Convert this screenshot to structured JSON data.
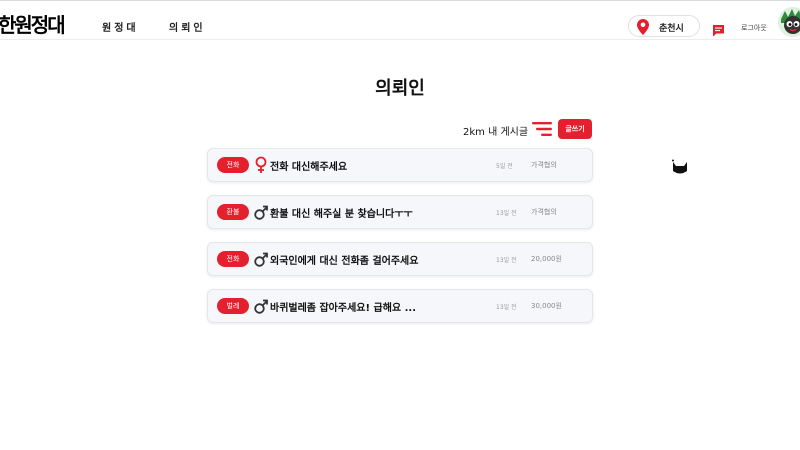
{
  "header": {
    "logo": "한원정대",
    "nav": [
      "원정대",
      "의뢰인"
    ],
    "location": "춘천시",
    "login": "로그아웃"
  },
  "main": {
    "title": "의뢰인",
    "radius_label": "2km 내 게시글",
    "write_button": "글쓰기",
    "posts": [
      {
        "category": "전화",
        "gender": "female",
        "title": "전화 대신해주세요",
        "time": "5일 전",
        "price": "가격협의"
      },
      {
        "category": "환불",
        "gender": "male",
        "title": "환불 대신 해주실 분 찾습니다ㅜㅜ",
        "time": "13일 전",
        "price": "가격협의"
      },
      {
        "category": "전화",
        "gender": "male",
        "title": "외국인에게 대신 전화좀 걸어주세요",
        "time": "13일 전",
        "price": "20,000원"
      },
      {
        "category": "벌레",
        "gender": "male",
        "title": "바퀴벌레좀 잡아주세요! 급해요 ...",
        "time": "13일 전",
        "price": "30,000원"
      }
    ]
  },
  "colors": {
    "accent": "#e5202e",
    "female_icon": "#e5202e",
    "male_icon": "#333333"
  },
  "icons": [
    "map-pin-icon",
    "chat-icon",
    "filter-icon",
    "female-icon",
    "male-icon",
    "avatar-mascot"
  ]
}
